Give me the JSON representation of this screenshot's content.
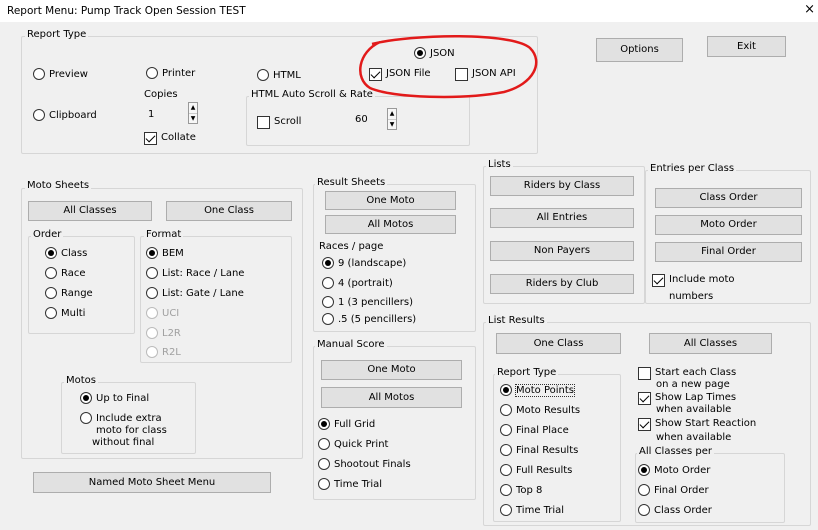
{
  "window": {
    "title": "Report Menu: Pump Track Open Session TEST",
    "close": "×"
  },
  "report_type": {
    "label": "Report Type",
    "preview": "Preview",
    "printer": "Printer",
    "html": "HTML",
    "clipboard": "Clipboard",
    "copies_label": "Copies",
    "copies_value": "1",
    "collate": "Collate",
    "json": "JSON",
    "json_file": "JSON File",
    "json_api": "JSON API",
    "html_auto_label": "HTML Auto Scroll & Rate",
    "scroll": "Scroll",
    "rate_value": "60"
  },
  "top_buttons": {
    "options": "Options",
    "exit": "Exit"
  },
  "moto_sheets": {
    "label": "Moto Sheets",
    "all_classes": "All Classes",
    "one_class": "One Class",
    "order_label": "Order",
    "order": [
      "Class",
      "Race",
      "Range",
      "Multi"
    ],
    "format_label": "Format",
    "format": [
      "BEM",
      "List: Race / Lane",
      "List: Gate / Lane",
      "UCI",
      "L2R",
      "R2L"
    ],
    "motos_label": "Motos",
    "up_to_final": "Up to Final",
    "include_extra": [
      "Include extra",
      "moto for class",
      "without final"
    ],
    "named_menu": "Named Moto Sheet Menu"
  },
  "result_sheets": {
    "label": "Result Sheets",
    "one_moto": "One Moto",
    "all_motos": "All Motos",
    "races_label": "Races / page",
    "races": [
      "9 (landscape)",
      "4 (portrait)",
      "1 (3 pencillers)",
      ".5 (5 pencillers)"
    ]
  },
  "manual_score": {
    "label": "Manual Score",
    "one_moto": "One Moto",
    "all_motos": "All Motos",
    "options": [
      "Full Grid",
      "Quick Print",
      "Shootout Finals",
      "Time Trial"
    ]
  },
  "lists": {
    "label": "Lists",
    "buttons": [
      "Riders by Class",
      "All Entries",
      "Non Payers",
      "Riders by Club"
    ]
  },
  "entries_per_class": {
    "label": "Entries per Class",
    "buttons": [
      "Class Order",
      "Moto Order",
      "Final Order"
    ],
    "include": [
      "Include moto",
      "numbers"
    ]
  },
  "list_results": {
    "label": "List Results",
    "one_class": "One Class",
    "all_classes": "All Classes",
    "report_type_label": "Report Type",
    "report_types": [
      "Moto Points",
      "Moto Results",
      "Final Place",
      "Final Results",
      "Full Results",
      "Top 8",
      "Time Trial"
    ],
    "start_each": [
      "Start each Class",
      "on a new page"
    ],
    "show_lap": [
      "Show Lap Times",
      "when available"
    ],
    "show_start": [
      "Show Start Reaction",
      "when available"
    ],
    "all_classes_per_label": "All Classes per",
    "per": [
      "Moto Order",
      "Final Order",
      "Class Order"
    ]
  },
  "annotation": {
    "color": "#e21a1a"
  }
}
